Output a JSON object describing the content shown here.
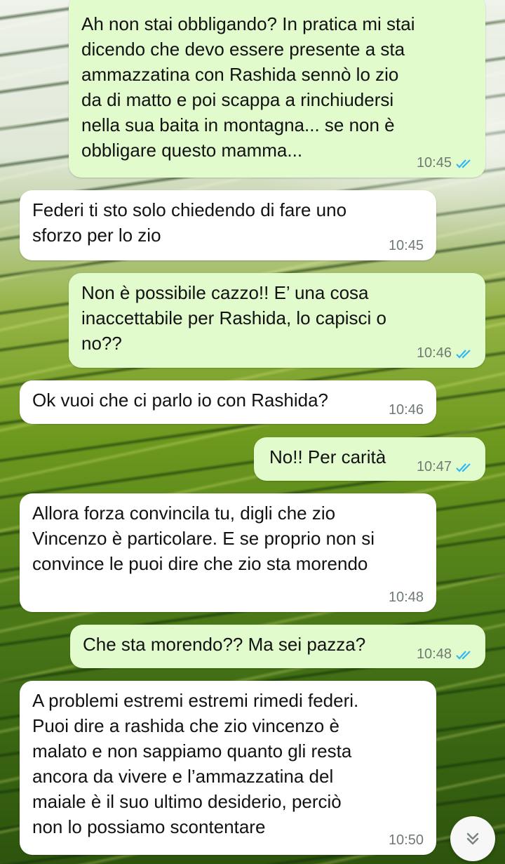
{
  "chat": {
    "messages": [
      {
        "direction": "outgoing",
        "text": "Ah non stai obbligando? In pratica mi stai\ndicendo che devo essere presente a sta\nammazzatina con Rashida sennò lo zio\nda di matto e poi scappa a rinchiudersi\nnella sua baita in montagna... se non è\nobbligare questo mamma...",
        "time": "10:45",
        "status": "read-icon"
      },
      {
        "direction": "incoming",
        "text": "Federi ti sto solo chiedendo di fare uno\nsforzo per lo zio",
        "time": "10:45"
      },
      {
        "direction": "outgoing",
        "text": "Non è possibile cazzo!! E’ una cosa\ninaccettabile per Rashida, lo capisci o\nno??",
        "time": "10:46",
        "status": "read-icon"
      },
      {
        "direction": "incoming",
        "text": "Ok vuoi che ci parlo io con Rashida?",
        "time": "10:46"
      },
      {
        "direction": "outgoing",
        "text": "No!! Per carità",
        "time": "10:47",
        "status": "read-icon"
      },
      {
        "direction": "incoming",
        "text": "Allora forza convincila tu, digli che zio\nVincenzo è particolare. E se proprio non si\nconvince le puoi dire che zio sta morendo",
        "time": "10:48"
      },
      {
        "direction": "outgoing",
        "text": "Che sta morendo?? Ma sei pazza?",
        "time": "10:48",
        "status": "read-icon"
      },
      {
        "direction": "incoming",
        "text": "A problemi estremi estremi rimedi federi.\nPuoi dire a rashida che zio vincenzo è\nmalato e non sappiamo quanto gli resta\nancora da vivere e l’ammazzatina del\nmaiale è il suo ultimo desiderio, perciò\nnon lo possiamo scontentare",
        "time": "10:50"
      }
    ]
  },
  "scroll_button": {
    "icon": "double-chevron-down-icon"
  },
  "colors": {
    "incoming_bubble": "#ffffff",
    "outgoing_bubble": "#e1fbcd",
    "read_tick": "#34b7f1",
    "timestamp": "#6f7a73"
  }
}
